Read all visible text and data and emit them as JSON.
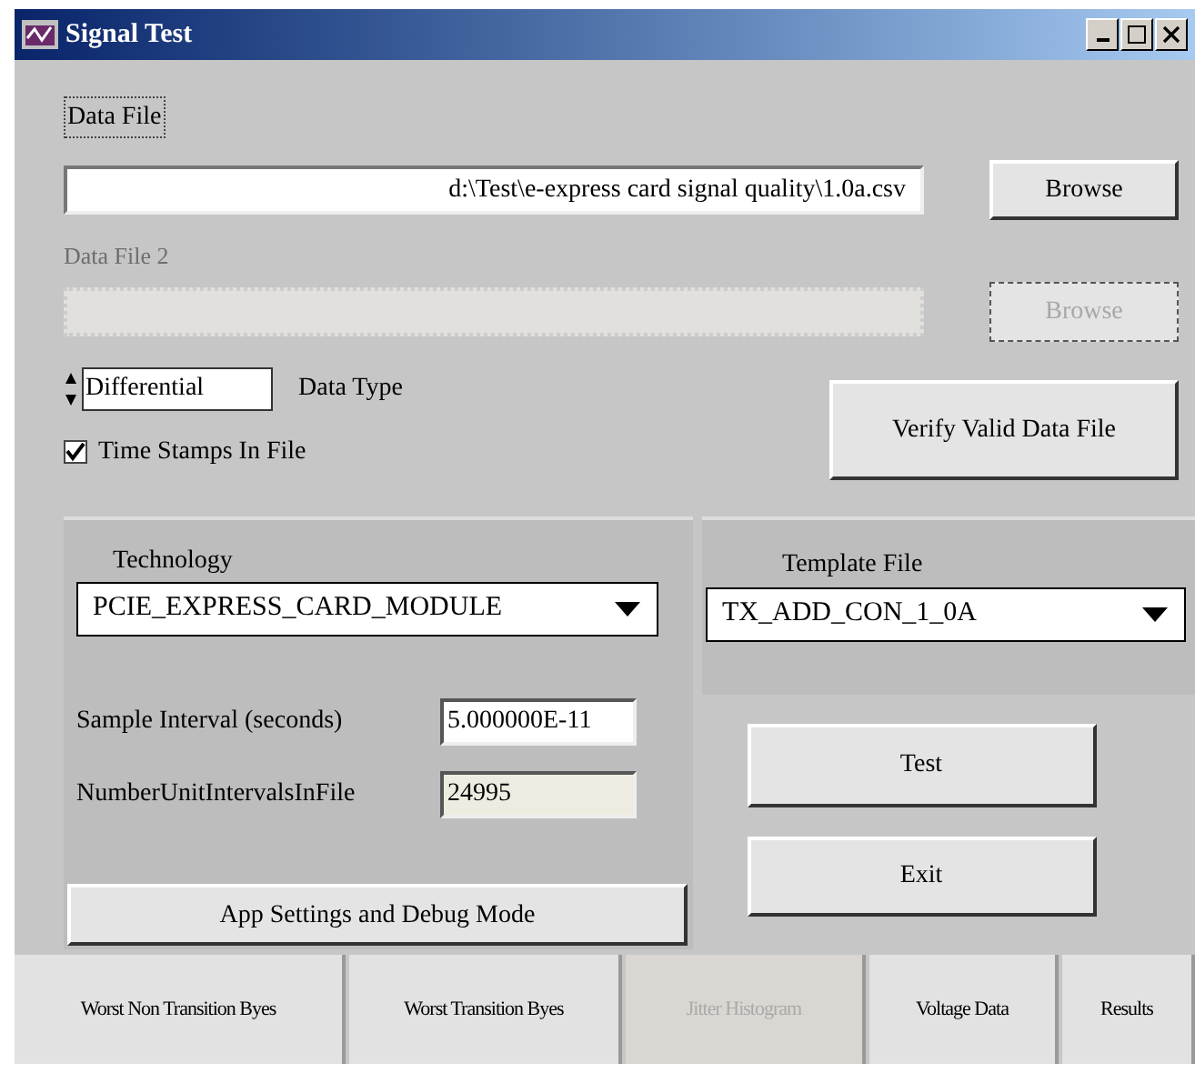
{
  "window": {
    "title": "Signal Test"
  },
  "data_file": {
    "label": "Data File",
    "value": "d:\\Test\\e-express card signal quality\\1.0a.csv",
    "browse": "Browse",
    "disabled": false
  },
  "data_file_2": {
    "label": "Data File 2",
    "browse": "Browse",
    "disabled": true
  },
  "data_type": {
    "value": "Differential",
    "label": "Data Type"
  },
  "time_stamps": {
    "label": "Time Stamps In File",
    "checked": true
  },
  "verify_button": "Verify Valid Data File",
  "technology": {
    "label": "Technology",
    "value": "PCIE_EXPRESS_CARD_MODULE"
  },
  "template_file": {
    "label": "Template File",
    "value": "TX_ADD_CON_1_0A"
  },
  "sample_interval": {
    "label": "Sample Interval (seconds)",
    "value": "5.000000E-11"
  },
  "unit_intervals": {
    "label": "NumberUnitIntervalsInFile",
    "value": "24995"
  },
  "settings_button": "App Settings and Debug Mode",
  "test_button": "Test",
  "exit_button": "Exit",
  "tabs": [
    {
      "label": "Worst Non Transition Byes",
      "selected": false,
      "disabled": false
    },
    {
      "label": "Worst Transition Byes",
      "selected": false,
      "disabled": false
    },
    {
      "label": "Jitter Histogram",
      "selected": false,
      "disabled": true
    },
    {
      "label": "Voltage Data",
      "selected": false,
      "disabled": false
    },
    {
      "label": "Results",
      "selected": false,
      "disabled": false
    }
  ]
}
